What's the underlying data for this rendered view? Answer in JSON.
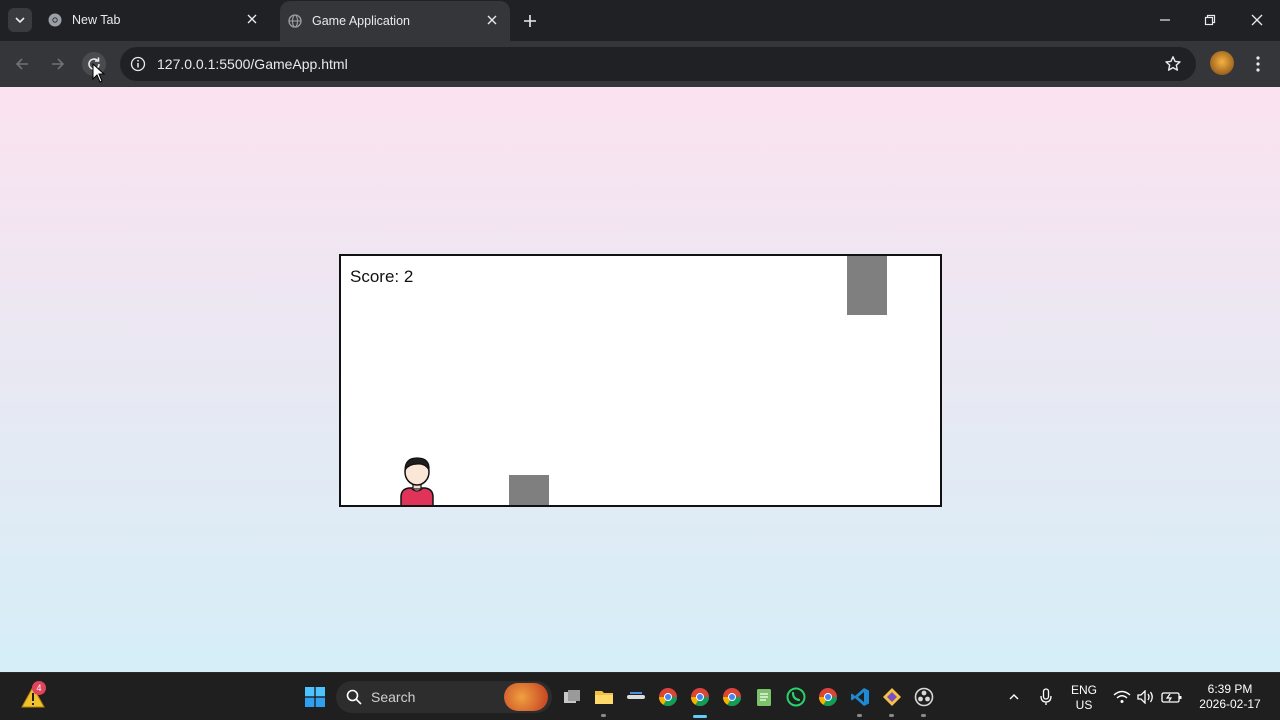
{
  "browser": {
    "tabs": [
      {
        "title": "New Tab",
        "active": false
      },
      {
        "title": "Game Application",
        "active": true
      }
    ],
    "url": "127.0.0.1:5500/GameApp.html"
  },
  "game": {
    "score_label": "Score: 2"
  },
  "taskbar": {
    "search_label": "Search",
    "warning_badge": "4",
    "lang_top": "ENG",
    "lang_bottom": "US",
    "time": "6:39 PM",
    "date": "2026-02-17"
  },
  "colors": {
    "page_gradient_top": "#fbe2f0",
    "page_gradient_bottom": "#d5eef8",
    "obstacle": "#7f7f7f",
    "player_shirt": "#e0335a"
  }
}
